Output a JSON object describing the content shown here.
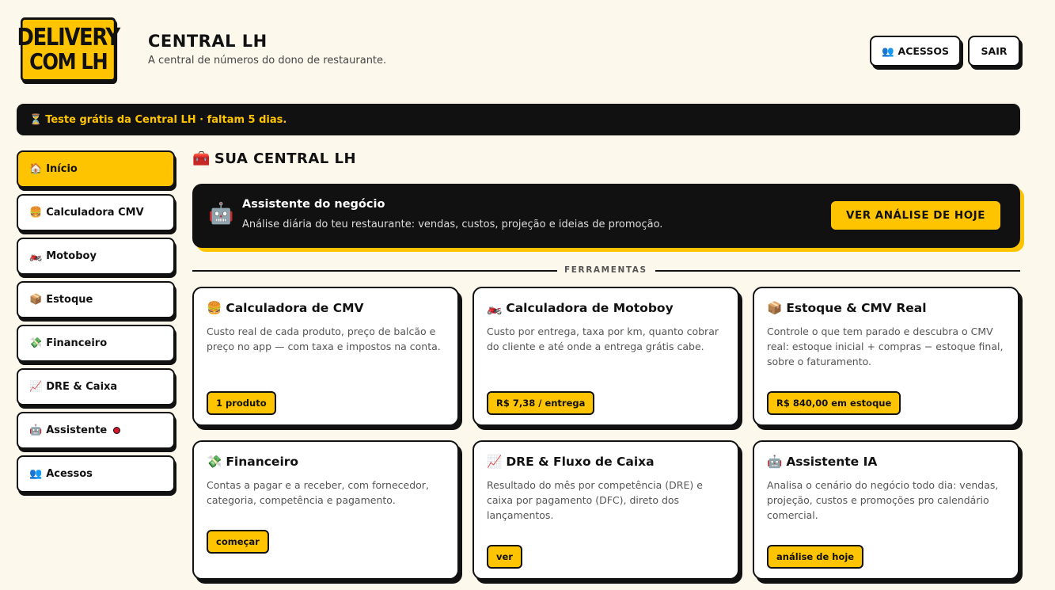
{
  "brand": {
    "logo_line1": "DELIVERY",
    "logo_line2": "COM LH",
    "title": "CENTRAL LH",
    "subtitle": "A central de números do dono de restaurante."
  },
  "header": {
    "acessos_icon": "👥",
    "acessos_label": "ACESSOS",
    "sair_label": "SAIR"
  },
  "trial": {
    "icon": "⏳",
    "text": "Teste grátis da Central LH · faltam 5 dias."
  },
  "sidebar": {
    "items": [
      {
        "icon": "🏠",
        "label": "Início",
        "active": true
      },
      {
        "icon": "🍔",
        "label": "Calculadora CMV"
      },
      {
        "icon": "🏍️",
        "label": "Motoboy"
      },
      {
        "icon": "📦",
        "label": "Estoque"
      },
      {
        "icon": "💸",
        "label": "Financeiro"
      },
      {
        "icon": "📈",
        "label": "DRE & Caixa"
      },
      {
        "icon": "🤖",
        "label": "Assistente"
      },
      {
        "icon": "👥",
        "label": "Acessos"
      }
    ]
  },
  "main": {
    "section_icon": "🧰",
    "section_title": "SUA CENTRAL LH",
    "assistant": {
      "icon": "🤖",
      "title": "Assistente do negócio",
      "description": "Análise diária do teu restaurante: vendas, custos, projeção e ideias de promoção.",
      "button": "VER ANÁLISE DE HOJE"
    },
    "divider_label": "FERRAMENTAS",
    "cards": [
      {
        "icon": "🍔",
        "title": "Calculadora de CMV",
        "description": "Custo real de cada produto, preço de balcão e preço no app — com taxa e impostos na conta.",
        "tag": "1 produto"
      },
      {
        "icon": "🏍️",
        "title": "Calculadora de Motoboy",
        "description": "Custo por entrega, taxa por km, quanto cobrar do cliente e até onde a entrega grátis cabe.",
        "tag": "R$ 7,38 / entrega"
      },
      {
        "icon": "📦",
        "title": "Estoque & CMV Real",
        "description": "Controle o que tem parado e descubra o CMV real: estoque inicial + compras − estoque final, sobre o faturamento.",
        "tag": "R$ 840,00 em estoque"
      },
      {
        "icon": "💸",
        "title": "Financeiro",
        "description": "Contas a pagar e a receber, com fornecedor, categoria, competência e pagamento.",
        "tag": "começar"
      },
      {
        "icon": "📈",
        "title": "DRE & Fluxo de Caixa",
        "description": "Resultado do mês por competência (DRE) e caixa por pagamento (DFC), direto dos lançamentos.",
        "tag": "ver"
      },
      {
        "icon": "🤖",
        "title": "Assistente IA",
        "description": "Analisa o cenário do negócio todo dia: vendas, projeção, custos e promoções pro calendário comercial.",
        "tag": "análise de hoje"
      }
    ]
  },
  "colors": {
    "accent": "#ffc400",
    "dark": "#111111",
    "background": "#fdf8ec",
    "notification": "#d3182b"
  },
  "icons": {
    "logo": "delivery-com-lh-logo"
  }
}
